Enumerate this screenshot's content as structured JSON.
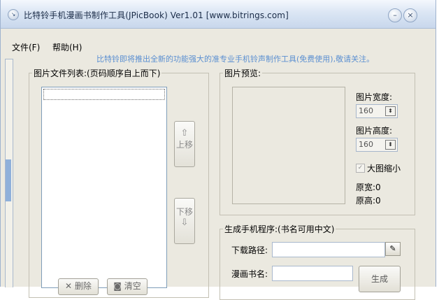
{
  "window": {
    "title": "比特铃手机漫画书制作工具(JPicBook) Ver1.01 [www.bitrings.com]",
    "minimize_glyph": "–",
    "close_glyph": "×"
  },
  "menu": {
    "file": "文件(F)",
    "help": "帮助(H)"
  },
  "promo_text": "比特铃即将推出全新的功能强大的准专业手机铃声制作工具(免费使用),敬请关注。",
  "file_list": {
    "group_label": "图片文件列表:(页码顺序自上而下)",
    "move_up_arrow": "⇧",
    "move_up_label": "上移",
    "move_down_label": "下移",
    "move_down_arrow": "⇩",
    "delete_label": "删除",
    "clear_label": "清空"
  },
  "preview": {
    "group_label": "图片预览:",
    "width_label": "图片宽度:",
    "width_value": "160",
    "height_label": "图片高度:",
    "height_value": "160",
    "shrink_label": "大图缩小",
    "shrink_checked": true,
    "orig_width_label": "原宽:",
    "orig_width_value": "0",
    "orig_height_label": "原高:",
    "orig_height_value": "0"
  },
  "generate": {
    "group_label": "生成手机程序:(书名可用中文)",
    "path_label": "下载路径:",
    "path_value": "",
    "title_label": "漫画书名:",
    "title_value": "",
    "generate_label": "生成"
  },
  "colors": {
    "window_bg": "#ebe9e0",
    "promo_text": "#5b8fd1",
    "titlebar_top": "#f4f8fd",
    "titlebar_bottom": "#c8d7ec"
  }
}
